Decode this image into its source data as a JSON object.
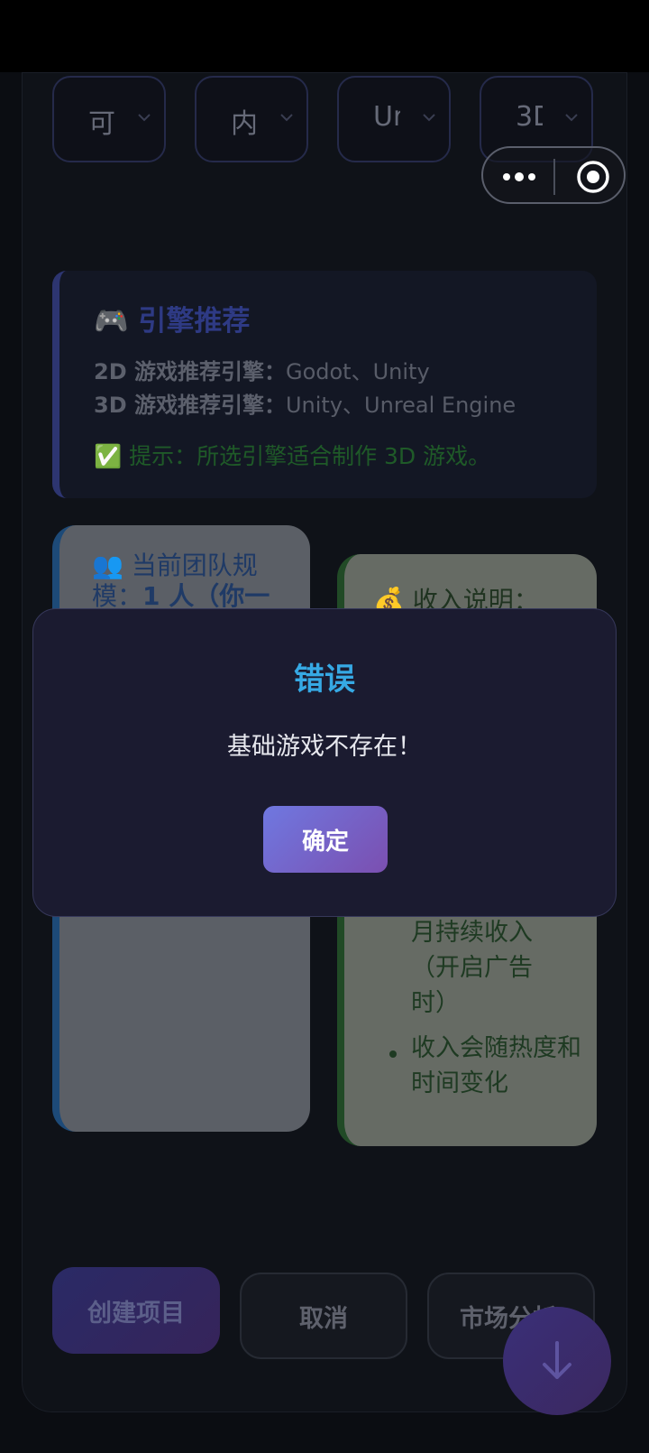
{
  "dropdowns": [
    {
      "value": "可"
    },
    {
      "value": "内"
    },
    {
      "value": "Ur"
    },
    {
      "value": "3D"
    }
  ],
  "capsule": {
    "more_icon": "more-dots-icon",
    "close_icon": "target-circle-icon"
  },
  "engine": {
    "title": "🎮 引擎推荐",
    "line1_label": "2D 游戏推荐引擎：",
    "line1_value": "Godot、Unity",
    "line2_label": "3D 游戏推荐引擎：",
    "line2_value": "Unity、Unreal Engine",
    "tip": "✅ 提示：所选引擎适合制作 3D 游戏。"
  },
  "team": {
    "label": "👥 当前团队规模：",
    "value": "1 人（你一"
  },
  "income": {
    "title": "💰 收入说明：",
    "lines": [
      "月持续收入",
      "（开启广告",
      "时）"
    ],
    "bullet": "收入会随热度和时间变化"
  },
  "buttons": {
    "create": "创建项目",
    "cancel": "取消",
    "market": "市场分析"
  },
  "fab": {
    "icon": "arrow-down-icon"
  },
  "modal": {
    "title": "错误",
    "message": "基础游戏不存在！",
    "confirm": "确定"
  },
  "colors": {
    "accent": "#36a9e4",
    "button_gradient_start": "#6f78e0",
    "button_gradient_end": "#7b4fb0"
  }
}
